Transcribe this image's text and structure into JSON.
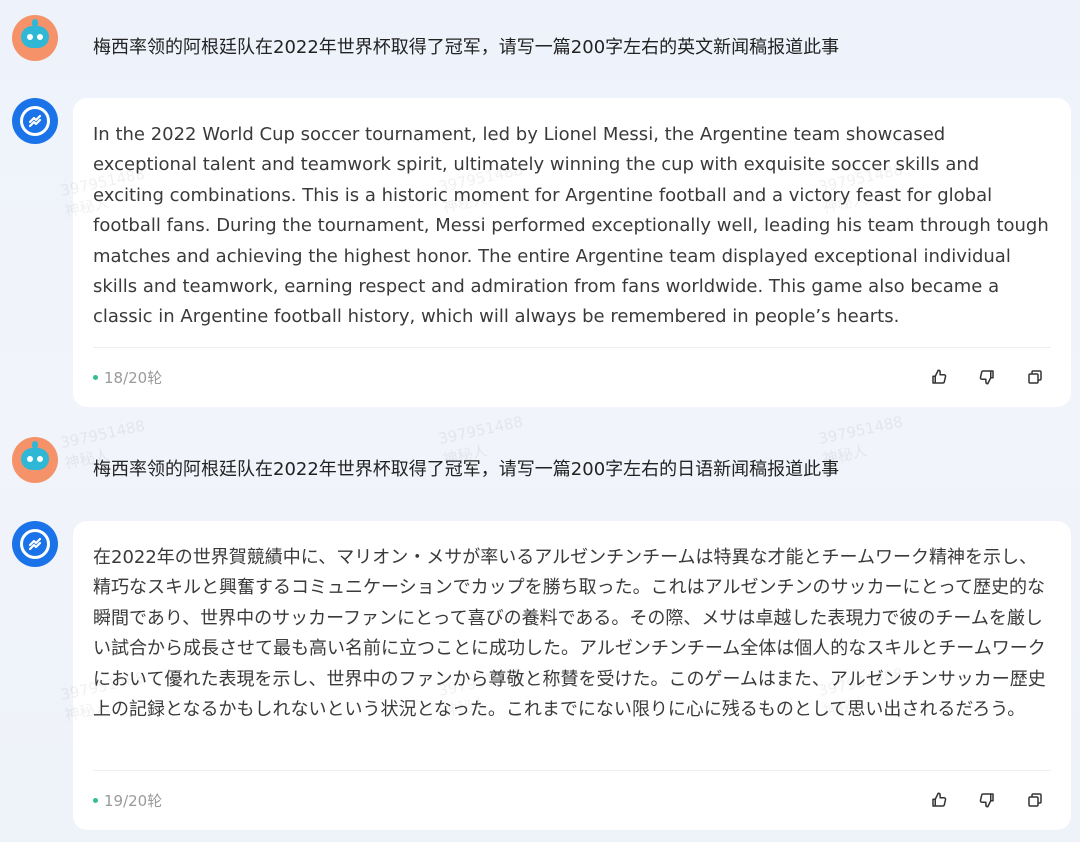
{
  "conversation": {
    "q1": "梅西率领的阿根廷队在2022年世界杯取得了冠军，请写一篇200字左右的英文新闻稿报道此事",
    "a1": "In the 2022 World Cup soccer tournament, led by Lionel Messi, the Argentine team showcased exceptional talent and teamwork spirit, ultimately winning the cup with exquisite soccer skills and exciting combinations. This is a historic moment for Argentine football and a victory feast for global football fans. During the tournament, Messi performed exceptionally well, leading his team through tough matches and achieving the highest honor. The entire Argentine team displayed exceptional individual skills and teamwork, earning respect and admiration from fans worldwide. This game also became a classic in Argentine football history, which will always be remembered in people’s hearts.",
    "a1_turn": "18/20轮",
    "q2": "梅西率领的阿根廷队在2022年世界杯取得了冠军，请写一篇200字左右的日语新闻稿报道此事",
    "a2": "在2022年の世界賀競績中に、マリオン・メサが率いるアルゼンチンチームは特異な才能とチームワーク精神を示し、精巧なスキルと興奮するコミュニケーションでカップを勝ち取った。これはアルゼンチンのサッカーにとって歴史的な瞬間であり、世界中のサッカーファンにとって喜びの養料である。その際、メサは卓越した表現力で彼のチームを厳しい試合から成長させて最も高い名前に立つことに成功した。アルゼンチンチーム全体は個人的なスキルとチームワークにおいて優れた表現を示し、世界中のファンから尊敬と称賛を受けた。このゲームはまた、アルゼンチンサッカー歴史上の記録となるかもしれないという状況となった。これまでにない限りに心に残るものとして思い出されるだろう。",
    "a2_turn": "19/20轮"
  },
  "watermark": {
    "id": "397951488",
    "label": "神秘人"
  },
  "icons": {
    "like": "thumbs-up-icon",
    "dislike": "thumbs-down-icon",
    "copy": "copy-icon"
  },
  "colors": {
    "accent": "#1a73e8",
    "turn_dot": "#35c08a",
    "user_avatar": "#f5926a"
  }
}
